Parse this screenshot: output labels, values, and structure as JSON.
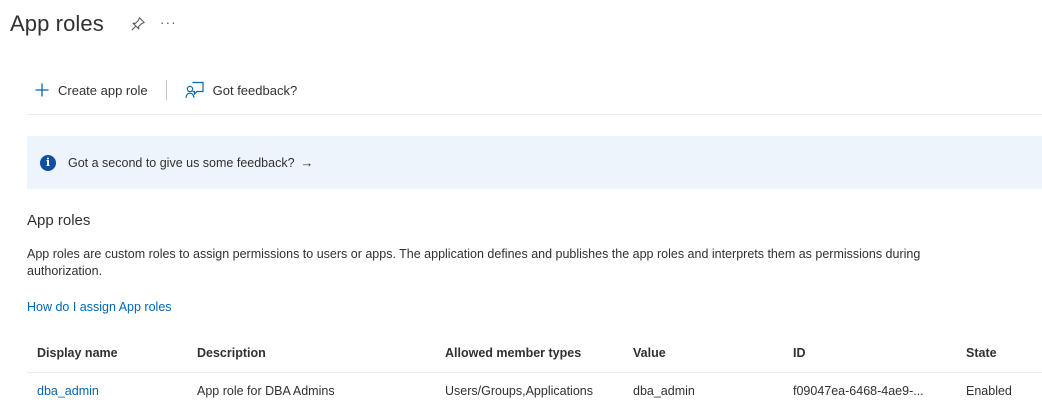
{
  "header": {
    "title": "App roles",
    "pin_icon": "pin-icon",
    "more_label": "···"
  },
  "commands": {
    "create_label": "Create app role",
    "create_icon": "plus-icon",
    "feedback_label": "Got feedback?",
    "feedback_icon": "feedback-icon"
  },
  "banner": {
    "text": "Got a second to give us some feedback?",
    "arrow": "→",
    "icon": "info-icon",
    "background": "#eef4fb"
  },
  "section": {
    "title": "App roles",
    "description": "App roles are custom roles to assign permissions to users or apps. The application defines and publishes the app roles and interprets them as permissions during authorization.",
    "help_link": "How do I assign App roles"
  },
  "table": {
    "columns": [
      "Display name",
      "Description",
      "Allowed member types",
      "Value",
      "ID",
      "State"
    ],
    "rows": [
      {
        "display_name": "dba_admin",
        "description": "App role for DBA Admins",
        "allowed_member_types": "Users/Groups,Applications",
        "value": "dba_admin",
        "id": "f09047ea-6468-4ae9-...",
        "state": "Enabled"
      }
    ]
  },
  "colors": {
    "accent": "#0067b8",
    "info_icon": "#0f4ea0",
    "text": "#323130"
  }
}
